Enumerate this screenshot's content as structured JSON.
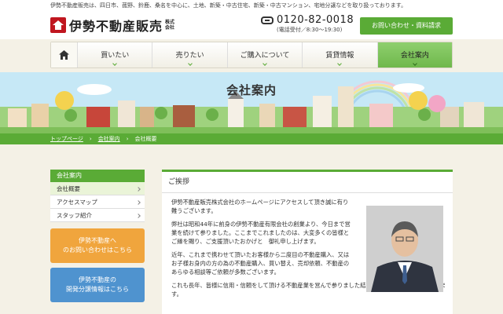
{
  "top_strip": "伊勢不動産販売は、四日市、菰野、鈴鹿、桑名を中心に、土地、新築・中古住宅、新築・中古マンション、宅地分譲などを取り扱っております。",
  "logo": {
    "name": "伊勢不動産販売",
    "sub1": "株式",
    "sub2": "会社"
  },
  "phone": {
    "number": "0120-82-0018",
    "hours": "(電話受付／8:30〜19:30)"
  },
  "contact_button": "お問い合わせ・資料請求",
  "nav": {
    "items": [
      {
        "label": "買いたい"
      },
      {
        "label": "売りたい"
      },
      {
        "label": "ご購入について"
      },
      {
        "label": "賃貸情報"
      },
      {
        "label": "会社案内"
      }
    ]
  },
  "hero_title": "会社案内",
  "breadcrumb": {
    "home": "トップページ",
    "mid": "会社案内",
    "current": "会社概要"
  },
  "sidebar": {
    "heading": "会社案内",
    "items": [
      {
        "label": "会社概要"
      },
      {
        "label": "アクセスマップ"
      },
      {
        "label": "スタッフ紹介"
      }
    ],
    "banner1": {
      "line1": "伊勢不動産へ",
      "line2": "のお問い合わせはこちら"
    },
    "banner2": {
      "line1": "伊勢不動産の",
      "line2": "開発分譲情報はこちら"
    }
  },
  "main": {
    "heading": "ご挨拶",
    "p1": "伊勢不動産販売株式会社のホームページにアクセスして頂き誠に有り難うございます。",
    "p2": "弊社は昭和44年に前身の伊勢不動産有限会社の創業より、今日まで営業を続けて参りました。ここまでこれましたのは、大変多くの皆様とご縁を賜り、ご支援頂いたおかげと　御礼申し上げます。",
    "p3": "近年、これまで携わせて頂いたお客様から二度目の不動産購入、又はお子様お身内の方の為の不動産購入、買い替え、売却依頼、不動産のあらゆる相談等ご依頼が多数ございます。",
    "p4": "これも長年、皆様に信用・信頼をして頂ける不動産業を営んで参りました結果だと、感謝申し上げております。"
  }
}
